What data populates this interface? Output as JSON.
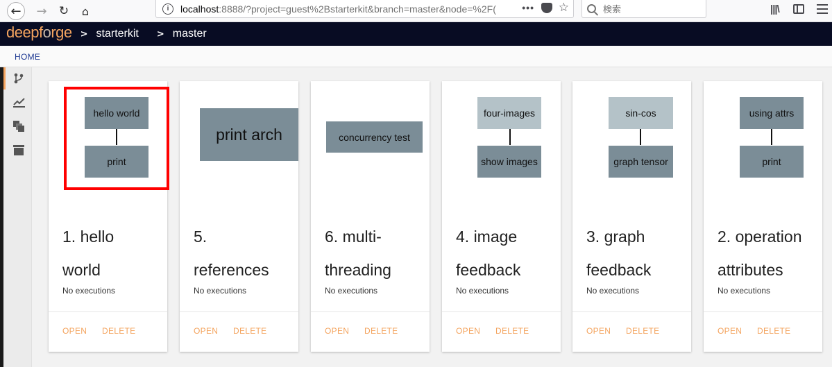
{
  "browser": {
    "url_host": "localhost",
    "url_rest": ":8888/?project=guest%2Bstarterkit&branch=master&node=%2F(",
    "more_label": "•••",
    "search_placeholder": "検索"
  },
  "header": {
    "logo_part1": "deep",
    "logo_part2": "f",
    "logo_part3": "o",
    "logo_part4": "rge",
    "breadcrumbs": [
      "starterkit",
      "master"
    ],
    "separator": ">"
  },
  "subnav": {
    "home_label": "HOME"
  },
  "cards": [
    {
      "title_line1": "1. hello",
      "title_line2": "world",
      "status": "No executions",
      "open_label": "OPEN",
      "delete_label": "DELETE",
      "nodes": [
        "hello world",
        "print"
      ]
    },
    {
      "title_line1": "5.",
      "title_line2": "references",
      "status": "No executions",
      "open_label": "OPEN",
      "delete_label": "DELETE",
      "nodes": [
        "print arch"
      ]
    },
    {
      "title_line1": "6. multi-",
      "title_line2": "threading",
      "status": "No executions",
      "open_label": "OPEN",
      "delete_label": "DELETE",
      "nodes": [
        "concurrency test"
      ]
    },
    {
      "title_line1": "4. image",
      "title_line2": "feedback",
      "status": "No executions",
      "open_label": "OPEN",
      "delete_label": "DELETE",
      "nodes": [
        "four-images",
        "show images"
      ]
    },
    {
      "title_line1": "3. graph",
      "title_line2": "feedback",
      "status": "No executions",
      "open_label": "OPEN",
      "delete_label": "DELETE",
      "nodes": [
        "sin-cos",
        "graph tensor"
      ]
    },
    {
      "title_line1": "2. operation",
      "title_line2": "attributes",
      "status": "No executions",
      "open_label": "OPEN",
      "delete_label": "DELETE",
      "nodes": [
        "using attrs",
        "print"
      ]
    }
  ],
  "colors": {
    "accent": "#f4a45f",
    "header_bg": "#080c23",
    "node_dark": "#7b8d97",
    "node_light": "#b4c2c8",
    "highlight": "#ff0000"
  }
}
